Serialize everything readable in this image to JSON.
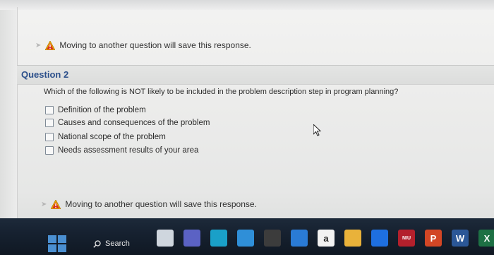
{
  "warnings": {
    "top": "Moving to another question will save this response.",
    "bottom": "Moving to another question will save this response."
  },
  "question": {
    "title": "Question 2",
    "text": "Which of the following is NOT likely to be included in the problem description step in program planning?",
    "options": [
      {
        "label": "Definition of the problem",
        "checked": false
      },
      {
        "label": "Causes and consequences of the problem",
        "checked": false
      },
      {
        "label": "National scope of the problem",
        "checked": false
      },
      {
        "label": "Needs assessment results of your area",
        "checked": false
      }
    ]
  },
  "taskbar": {
    "search_label": "Search",
    "apps": [
      {
        "icon": "file-explorer-icon",
        "color": "#cfd6de"
      },
      {
        "icon": "teams-icon",
        "color": "#5b62c4"
      },
      {
        "icon": "edge-icon",
        "color": "#1aa0c8"
      },
      {
        "icon": "help-icon",
        "color": "#2f8fd8"
      },
      {
        "icon": "calculator-icon",
        "color": "#3c3c3c"
      },
      {
        "icon": "mail-icon",
        "color": "#2a7bd6"
      },
      {
        "icon": "amazon-icon",
        "color": "#f2f2f2",
        "text": "a"
      },
      {
        "icon": "files-icon",
        "color": "#e9b23a"
      },
      {
        "icon": "dropbox-icon",
        "color": "#1e6fe0"
      },
      {
        "icon": "niu-icon",
        "color": "#b3202c",
        "text": "NIU"
      },
      {
        "icon": "powerpoint-icon",
        "color": "#d24625",
        "text": "P"
      },
      {
        "icon": "word-icon",
        "color": "#2b5797",
        "text": "W"
      },
      {
        "icon": "excel-icon",
        "color": "#1d7044",
        "text": "X"
      }
    ]
  }
}
